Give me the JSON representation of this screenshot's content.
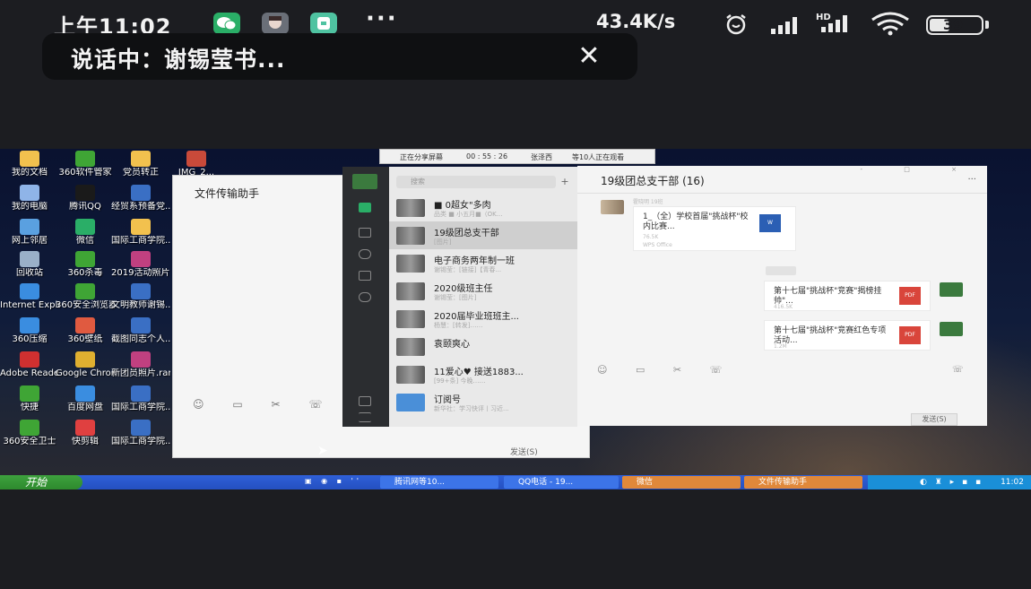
{
  "status_bar": {
    "time": "上午11:02",
    "more": "···",
    "net_speed": "43.4K/s",
    "network_label": "HD",
    "battery": "39",
    "battery_level": 0.39,
    "colors": {
      "wechat": "#2aae67",
      "notify": "#6a6f78",
      "app3": "#4fc3a1"
    }
  },
  "call_banner": {
    "text": "说话中：谢锡莹书...",
    "close": "✕"
  },
  "share_bar": {
    "sharing": "正在分享屏幕",
    "duration": "00 : 55 : 26",
    "presenter": "张泽西",
    "viewers": "等10人正在观看"
  },
  "desktop_icons": [
    {
      "label": "我的文档",
      "color": "#f2c14e"
    },
    {
      "label": "360软件管家",
      "color": "#3fa535"
    },
    {
      "label": "党员转正",
      "color": "#f2c14e"
    },
    {
      "label": "IMG_2...",
      "color": "#c94a3a"
    },
    {
      "label": "我的电脑",
      "color": "#8fb4e8"
    },
    {
      "label": "腾讯QQ",
      "color": "#1a1a1a"
    },
    {
      "label": "经贸系预备党...",
      "color": "#3a6fc4"
    },
    {
      "label": "网上邻居",
      "color": "#5aa0e0"
    },
    {
      "label": "微信",
      "color": "#2aae67"
    },
    {
      "label": "国际工商学院...",
      "color": "#f2c14e"
    },
    {
      "label": "回收站",
      "color": "#9ab0c8"
    },
    {
      "label": "360杀毒",
      "color": "#3fa535"
    },
    {
      "label": "2019活动照片.zip",
      "color": "#c04080"
    },
    {
      "label": "Internet Explorer",
      "color": "#3a8de0"
    },
    {
      "label": "360安全浏览器",
      "color": "#3fa535"
    },
    {
      "label": "文明教师谢锡...",
      "color": "#3a6fc4"
    },
    {
      "label": "360压缩",
      "color": "#3a8de0"
    },
    {
      "label": "360壁纸",
      "color": "#e05a40"
    },
    {
      "label": "截图同志个人...",
      "color": "#3a6fc4"
    },
    {
      "label": "Adobe Reader",
      "color": "#d03030"
    },
    {
      "label": "Google Chrome",
      "color": "#e0b030"
    },
    {
      "label": "新团员照片.rar",
      "color": "#c04080"
    },
    {
      "label": "快捷",
      "color": "#3fa535"
    },
    {
      "label": "百度网盘",
      "color": "#3a8de0"
    },
    {
      "label": "国际工商学院...",
      "color": "#3a6fc4"
    },
    {
      "label": "360安全卫士",
      "color": "#3fa535"
    },
    {
      "label": "快剪辑",
      "color": "#e04040"
    },
    {
      "label": "国际工商学院...",
      "color": "#3a6fc4"
    }
  ],
  "file_helper_window": {
    "title": "文件传输助手",
    "tools": "☺ ▭ ✂ ☏",
    "send": "发送(S)"
  },
  "wechat_list": {
    "search_placeholder": "搜索",
    "add": "+",
    "items": [
      {
        "name": "■ 0超女\"多肉",
        "preview": "品类 ■ 小五月■（OK...",
        "time": ""
      },
      {
        "name": "19级团总支干部",
        "preview": "[图片]",
        "time": ""
      },
      {
        "name": "电子商务两年制一班",
        "preview": "谢锡莹：[链接]【青春...",
        "time": ""
      },
      {
        "name": "2020级班主任",
        "preview": "谢锡莹：[图片]",
        "time": ""
      },
      {
        "name": "2020届毕业班班主...",
        "preview": "杨慧：[转发]……",
        "time": ""
      },
      {
        "name": "袁颐爽心",
        "preview": "",
        "time": ""
      },
      {
        "name": "11爱心♥ 接送1883...",
        "preview": "[99+条] 今晚……",
        "time": ""
      },
      {
        "name": "订阅号",
        "preview": "新华社：学习快评丨习近...",
        "time": ""
      }
    ]
  },
  "wechat_chat": {
    "title": "19级团总支干部 (16)",
    "more": "···",
    "window_buttons": "- □ ×",
    "messages": [
      {
        "sender": "霍晓明 19班",
        "text": "1_（全）学校首届\"挑战杯\"校内比赛...",
        "size": "76.5K",
        "meta": "WPS Office",
        "file": "W"
      },
      {
        "sender": "",
        "text": "第十七届\"挑战杯\"竞赛\"揭榜挂帅\"...",
        "size": "416.5K",
        "meta": "",
        "file": "PDF"
      },
      {
        "sender": "",
        "text": "第十七届\"挑战杯\"竞赛红色专项活动...",
        "size": "1.2M",
        "meta": "",
        "file": "PDF"
      }
    ],
    "tools": "☺ ▭ ✂ ☏",
    "call": "☏",
    "send": "发送(S)",
    "colors": {
      "word": "#2b5fb4",
      "pdf": "#d9453b"
    }
  },
  "taskbar": {
    "start": "开始",
    "quick_launch": "▣ ◉ ▪ ''",
    "tasks": [
      {
        "label": "腾讯网等10..."
      },
      {
        "label": "QQ电话 - 19..."
      },
      {
        "label": "微信"
      },
      {
        "label": "文件传输助手"
      }
    ],
    "clock": "11:02"
  }
}
